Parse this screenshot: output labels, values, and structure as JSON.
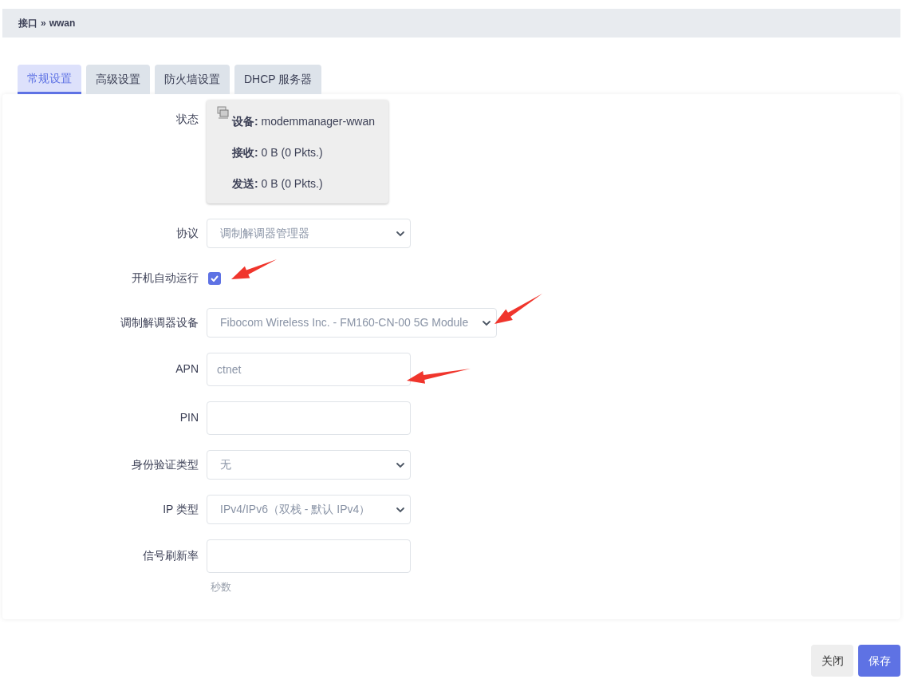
{
  "breadcrumb": {
    "parts": [
      "接口",
      "»",
      "wwan"
    ]
  },
  "tabs": [
    {
      "label": "常规设置",
      "selected": true
    },
    {
      "label": "高级设置",
      "selected": false
    },
    {
      "label": "防火墙设置",
      "selected": false
    },
    {
      "label": "DHCP 服务器",
      "selected": false
    }
  ],
  "fields": [
    {
      "kind": "status",
      "label": "状态",
      "lines": [
        {
          "key": "设备:",
          "value": "modemmanager-wwan"
        },
        {
          "key": "接收:",
          "value": "0 B (0 Pkts.)"
        },
        {
          "key": "发送:",
          "value": "0 B (0 Pkts.)"
        }
      ]
    },
    {
      "kind": "select",
      "label": "协议",
      "value": "调制解调器管理器"
    },
    {
      "kind": "checkbox",
      "label": "开机自动运行",
      "checked": true
    },
    {
      "kind": "select",
      "label": "调制解调器设备",
      "value": "Fibocom Wireless Inc. - FM160-CN-00 5G Module",
      "wide": true
    },
    {
      "kind": "text",
      "label": "APN",
      "value": "ctnet"
    },
    {
      "kind": "text",
      "label": "PIN"
    },
    {
      "kind": "select",
      "label": "身份验证类型",
      "value": "无"
    },
    {
      "kind": "select",
      "label": "IP 类型",
      "value": "IPv4/IPv6（双栈 - 默认 IPv4）"
    },
    {
      "kind": "text",
      "label": "信号刷新率",
      "hint": "秒数"
    }
  ],
  "buttons": [
    {
      "label": "关闭",
      "kind": "secondary"
    },
    {
      "label": "保存",
      "kind": "primary"
    }
  ]
}
